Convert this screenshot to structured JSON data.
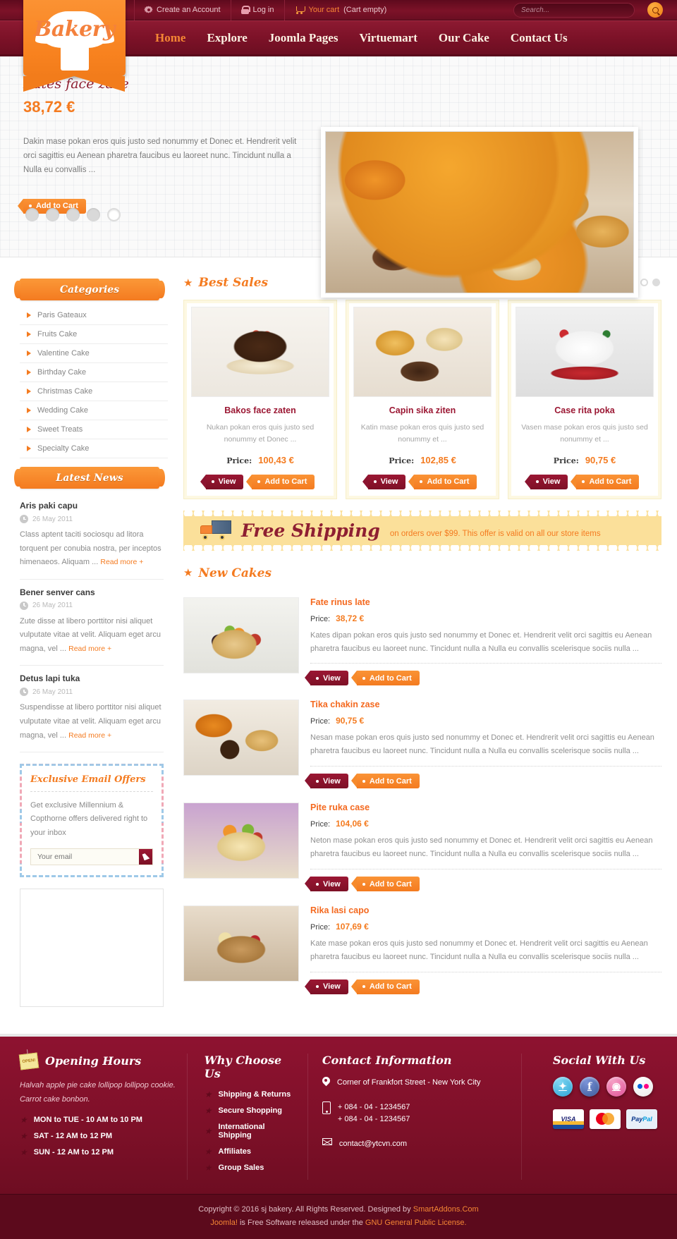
{
  "topbar": {
    "create_account": "Create an Account",
    "login": "Log in",
    "cart_label": "Your cart",
    "cart_status": "(Cart empty)",
    "search_placeholder": "Search...",
    "search_icon": "search-icon"
  },
  "logo": {
    "text": "Bakery"
  },
  "nav": {
    "items": [
      {
        "label": "Home",
        "active": true
      },
      {
        "label": "Explore",
        "active": false
      },
      {
        "label": "Joomla Pages",
        "active": false
      },
      {
        "label": "Virtuemart",
        "active": false
      },
      {
        "label": "Our Cake",
        "active": false
      },
      {
        "label": "Contact Us",
        "active": false
      }
    ]
  },
  "hero": {
    "title": "Kates face zace",
    "price": "38,72 €",
    "description": "Dakin mase pokan eros quis justo sed nonummy et Donec et. Hendrerit velit orci sagittis eu Aenean pharetra faucibus eu laoreet nunc. Tincidunt nulla a Nulla eu convallis ...",
    "cta": "Add to Cart",
    "slide_count": 5,
    "active_slide": 5
  },
  "sidebar": {
    "categories_title": "Categories",
    "categories": [
      "Paris Gateaux",
      "Fruits Cake",
      "Valentine Cake",
      "Birthday Cake",
      "Christmas Cake",
      "Wedding Cake",
      "Sweet Treats",
      "Specialty Cake"
    ],
    "news_title": "Latest News",
    "news": [
      {
        "title": "Aris paki capu",
        "date": "26 May 2011",
        "text": "Class aptent taciti sociosqu ad litora torquent per conubia nostra, per inceptos himenaeos. Aliquam ...",
        "readmore": "Read more +"
      },
      {
        "title": "Bener senver cans",
        "date": "26 May 2011",
        "text": "Zute disse at libero porttitor nisi aliquet vulputate vitae at velit. Aliquam eget arcu magna, vel ...",
        "readmore": "Read more +"
      },
      {
        "title": "Detus lapi tuka",
        "date": "26 May 2011",
        "text": "Suspendisse at libero porttitor nisi aliquet vulputate vitae at velit. Aliquam eget arcu magna, vel ...",
        "readmore": "Read more +"
      }
    ],
    "newsletter": {
      "title": "Exclusive Email Offers",
      "text": "Get exclusive Millennium & Copthorne offers delivered right to your inbox",
      "placeholder": "Your email",
      "submit_icon": "cursor-icon"
    }
  },
  "best_sales": {
    "title": "Best Sales",
    "star_icon": "star-icon",
    "dot_count": 3,
    "active_dot": 2,
    "products": [
      {
        "name": "Bakos face zaten",
        "desc": "Nukan pokan eros quis justo sed nonummy et Donec ...",
        "price_label": "Price:",
        "price": "100,43 €",
        "view": "View",
        "cart": "Add to Cart"
      },
      {
        "name": "Capin sika ziten",
        "desc": "Katin mase pokan eros quis justo sed nonummy et ...",
        "price_label": "Price:",
        "price": "102,85 €",
        "view": "View",
        "cart": "Add to Cart"
      },
      {
        "name": "Case rita poka",
        "desc": "Vasen mase pokan eros quis justo sed nonummy et ...",
        "price_label": "Price:",
        "price": "90,75 €",
        "view": "View",
        "cart": "Add to Cart"
      }
    ]
  },
  "shipping": {
    "icon": "truck-icon",
    "title": "Free Shipping",
    "subtitle": "on orders over $99. This offer is valid on all our store items"
  },
  "new_cakes": {
    "title": "New Cakes",
    "star_icon": "star-icon",
    "items": [
      {
        "name": "Fate rinus late",
        "price_label": "Price:",
        "price": "38,72 €",
        "desc": "Kates dipan pokan eros quis justo sed nonummy et Donec et. Hendrerit velit orci sagittis eu Aenean pharetra faucibus eu laoreet nunc. Tincidunt nulla a Nulla eu convallis scelerisque sociis nulla ...",
        "view": "View",
        "cart": "Add to Cart"
      },
      {
        "name": "Tika chakin zase",
        "price_label": "Price:",
        "price": "90,75 €",
        "desc": "Nesan mase pokan eros quis justo sed nonummy et Donec et. Hendrerit velit orci sagittis eu Aenean pharetra faucibus eu laoreet nunc. Tincidunt nulla a Nulla eu convallis scelerisque sociis nulla ...",
        "view": "View",
        "cart": "Add to Cart"
      },
      {
        "name": "Pite ruka case",
        "price_label": "Price:",
        "price": "104,06 €",
        "desc": "Neton mase pokan eros quis justo sed nonummy et Donec et. Hendrerit velit orci sagittis eu Aenean pharetra faucibus eu laoreet nunc. Tincidunt nulla a Nulla eu convallis scelerisque sociis nulla ...",
        "view": "View",
        "cart": "Add to Cart"
      },
      {
        "name": "Rika lasi capo",
        "price_label": "Price:",
        "price": "107,69 €",
        "desc": "Kate mase pokan eros quis justo sed nonummy et Donec et. Hendrerit velit orci sagittis eu Aenean pharetra faucibus eu laoreet nunc. Tincidunt nulla a Nulla eu convallis scelerisque sociis nulla ...",
        "view": "View",
        "cart": "Add to Cart"
      }
    ]
  },
  "footer": {
    "hours": {
      "title": "Opening Hours",
      "sign_text": "OPEN!",
      "note": "Halvah apple pie cake lollipop lollipop cookie. Carrot cake bonbon.",
      "rows": [
        "MON to TUE - 10 AM to 10 PM",
        "SAT - 12 AM to 12 PM",
        "SUN - 12 AM to 12 PM"
      ]
    },
    "why": {
      "title": "Why Choose Us",
      "items": [
        "Shipping & Returns",
        "Secure Shopping",
        "International Shipping",
        "Affiliates",
        "Group Sales"
      ]
    },
    "contact": {
      "title": "Contact Information",
      "address": "Corner of Frankfort Street - New York City",
      "phone1": "+ 084 - 04 - 1234567",
      "phone2": "+ 084 - 04 - 1234567",
      "email": "contact@ytcvn.com",
      "pin_icon": "location-pin-icon",
      "phone_icon": "phone-icon",
      "mail_icon": "envelope-icon"
    },
    "social": {
      "title": "Social With Us",
      "icons": [
        {
          "name": "twitter-icon",
          "glyph": "t"
        },
        {
          "name": "facebook-icon",
          "glyph": "f"
        },
        {
          "name": "dribbble-icon",
          "glyph": "●"
        },
        {
          "name": "flickr-icon",
          "glyph": ""
        }
      ],
      "payments": [
        {
          "name": "visa-icon",
          "label": "VISA"
        },
        {
          "name": "mastercard-icon",
          "label": "MasterCard"
        },
        {
          "name": "paypal-icon",
          "label": "PayPal"
        }
      ]
    }
  },
  "copyright": {
    "line1_pre": "Copyright © 2016 sj bakery. All Rights Reserved. Designed by ",
    "line1_link": "SmartAddons.Com",
    "line2_pre": "Joomla!",
    "line2_mid": " is Free Software released under the ",
    "line2_link": "GNU General Public License."
  },
  "colors": {
    "brand_orange": "#f47b20",
    "brand_maroon": "#7d1228",
    "accent_cream": "#fbe09a"
  }
}
